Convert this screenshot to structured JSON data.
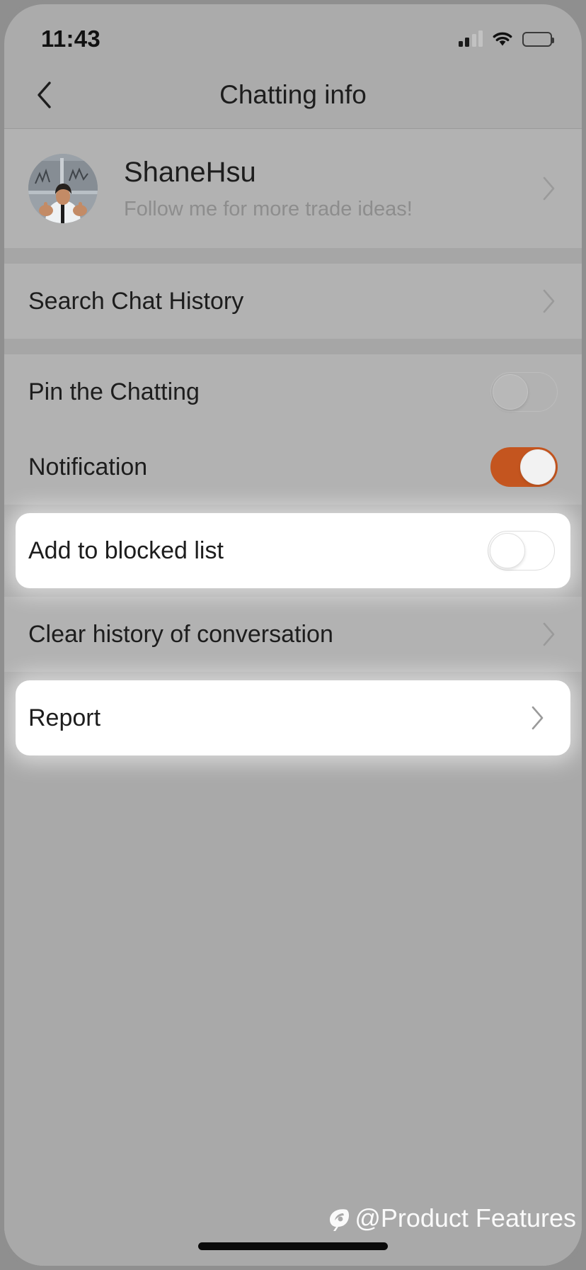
{
  "status_bar": {
    "time": "11:43",
    "signal_icon": "cellular-signal-icon",
    "wifi_icon": "wifi-icon",
    "battery_icon": "battery-icon",
    "signal_bars_filled": 2,
    "signal_bars_total": 4,
    "battery_level": 100
  },
  "nav": {
    "back_icon": "chevron-left-icon",
    "title": "Chatting info"
  },
  "profile": {
    "name": "ShaneHsu",
    "tagline": "Follow me for more trade ideas!",
    "avatar_alt": "trader-avatar",
    "chevron_icon": "chevron-right-icon"
  },
  "rows": {
    "search_chat_history": {
      "label": "Search Chat History",
      "accessory": "chevron-right-icon"
    },
    "pin_the_chatting": {
      "label": "Pin the Chatting",
      "toggle_state": "off"
    },
    "notification": {
      "label": "Notification",
      "toggle_state": "on"
    },
    "add_to_blocked_list": {
      "label": "Add to blocked list",
      "toggle_state": "off",
      "highlighted": true
    },
    "clear_history": {
      "label": "Clear history of conversation",
      "accessory": "chevron-right-icon"
    },
    "report": {
      "label": "Report",
      "accessory": "chevron-right-icon",
      "highlighted": true
    }
  },
  "watermark": {
    "text": "@Product Features",
    "logo_icon": "feather-logo-icon"
  },
  "colors": {
    "background": "#a9a9a9",
    "section": "#b2b2b2",
    "toggle_on": "#c4551f",
    "text_primary": "#1d1d1d",
    "text_secondary": "#8d8d8d",
    "highlight_card": "#ffffff"
  }
}
